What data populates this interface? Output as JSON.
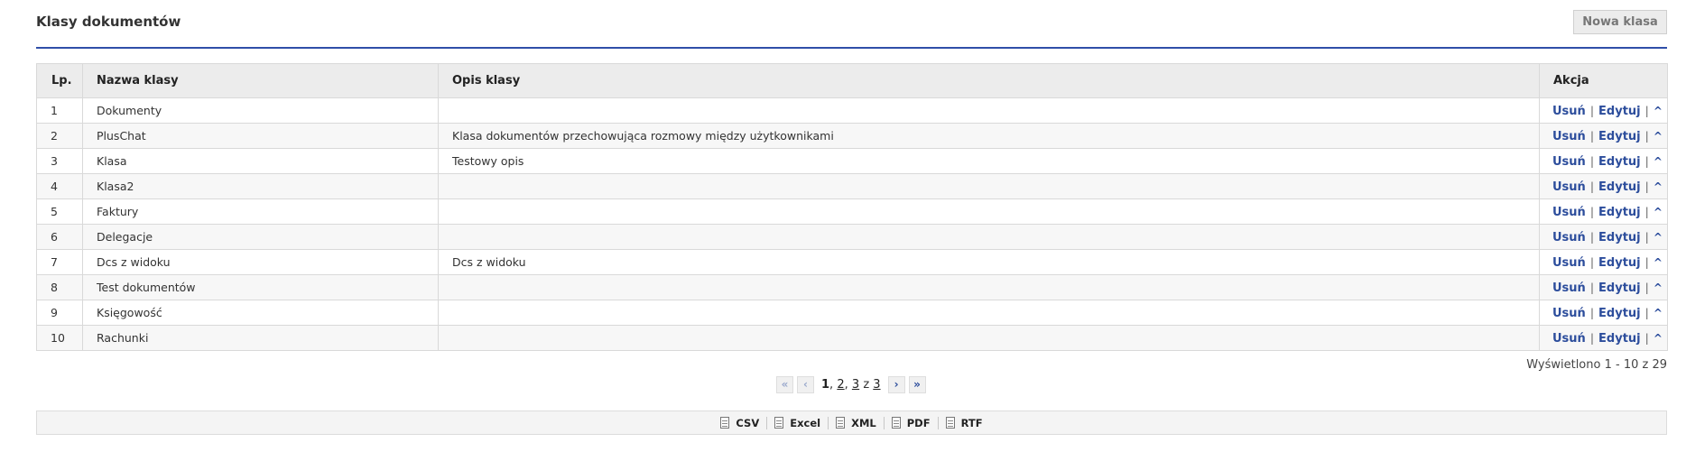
{
  "header": {
    "title": "Klasy dokumentów",
    "new_button_label": "Nowa klasa"
  },
  "table": {
    "columns": [
      "Lp.",
      "Nazwa klasy",
      "Opis klasy",
      "Akcja"
    ],
    "action_labels": {
      "delete": "Usuń",
      "edit": "Edytuj",
      "move_up": "^",
      "separator": "|"
    },
    "rows": [
      {
        "lp": "1",
        "name": "Dokumenty",
        "description": ""
      },
      {
        "lp": "2",
        "name": "PlusChat",
        "description": "Klasa dokumentów przechowująca rozmowy między użytkownikami"
      },
      {
        "lp": "3",
        "name": "Klasa",
        "description": "Testowy opis"
      },
      {
        "lp": "4",
        "name": "Klasa2",
        "description": ""
      },
      {
        "lp": "5",
        "name": "Faktury",
        "description": ""
      },
      {
        "lp": "6",
        "name": "Delegacje",
        "description": ""
      },
      {
        "lp": "7",
        "name": "Dcs z widoku",
        "description": "Dcs z widoku"
      },
      {
        "lp": "8",
        "name": "Test dokumentów",
        "description": ""
      },
      {
        "lp": "9",
        "name": "Księgowość",
        "description": ""
      },
      {
        "lp": "10",
        "name": "Rachunki",
        "description": ""
      }
    ]
  },
  "summary": "Wyświetlono 1 - 10 z 29",
  "pager": {
    "first": "«",
    "prev": "‹",
    "next": "›",
    "last": "»",
    "pages": [
      "1",
      "2",
      "3"
    ],
    "comma": ",",
    "of_label": "z",
    "total_pages": "3",
    "current_page": "1"
  },
  "export": {
    "items": [
      {
        "label": "CSV",
        "icon": "csv-file-icon"
      },
      {
        "label": "Excel",
        "icon": "excel-file-icon"
      },
      {
        "label": "XML",
        "icon": "xml-file-icon"
      },
      {
        "label": "PDF",
        "icon": "pdf-file-icon"
      },
      {
        "label": "RTF",
        "icon": "rtf-file-icon"
      }
    ]
  },
  "colors": {
    "accent": "#2f4fa8",
    "link": "#2c4d9c",
    "header_bg": "#ececec"
  }
}
